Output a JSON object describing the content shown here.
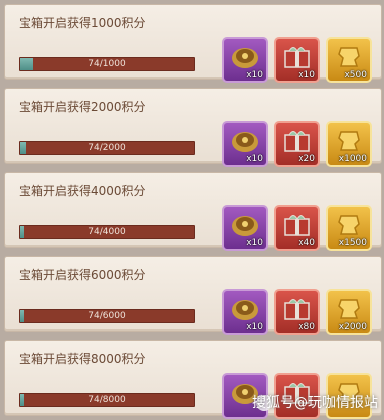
{
  "cards": [
    {
      "title": "宝箱开启获得1000积分",
      "progress_text": "74/1000",
      "progress": 0.074,
      "rewards": [
        {
          "icon": "treasure-chest-icon",
          "color": "purple",
          "count": "x10"
        },
        {
          "icon": "gift-box-icon",
          "color": "red",
          "count": "x10"
        },
        {
          "icon": "gold-ingot-icon",
          "color": "gold",
          "count": "x500"
        }
      ]
    },
    {
      "title": "宝箱开启获得2000积分",
      "progress_text": "74/2000",
      "progress": 0.037,
      "rewards": [
        {
          "icon": "treasure-chest-icon",
          "color": "purple",
          "count": "x10"
        },
        {
          "icon": "gift-box-icon",
          "color": "red",
          "count": "x20"
        },
        {
          "icon": "gold-ingot-icon",
          "color": "gold",
          "count": "x1000"
        }
      ]
    },
    {
      "title": "宝箱开启获得4000积分",
      "progress_text": "74/4000",
      "progress": 0.0185,
      "rewards": [
        {
          "icon": "treasure-chest-icon",
          "color": "purple",
          "count": "x10"
        },
        {
          "icon": "gift-box-icon",
          "color": "red",
          "count": "x40"
        },
        {
          "icon": "gold-ingot-icon",
          "color": "gold",
          "count": "x1500"
        }
      ]
    },
    {
      "title": "宝箱开启获得6000积分",
      "progress_text": "74/6000",
      "progress": 0.0123,
      "rewards": [
        {
          "icon": "treasure-chest-icon",
          "color": "purple",
          "count": "x10"
        },
        {
          "icon": "gift-box-icon",
          "color": "red",
          "count": "x80"
        },
        {
          "icon": "gold-ingot-icon",
          "color": "gold",
          "count": "x2000"
        }
      ]
    },
    {
      "title": "宝箱开启获得8000积分",
      "progress_text": "74/8000",
      "progress": 0.00925,
      "rewards": [
        {
          "icon": "treasure-chest-icon",
          "color": "purple",
          "count": ""
        },
        {
          "icon": "gift-box-icon",
          "color": "red",
          "count": ""
        },
        {
          "icon": "gold-ingot-icon",
          "color": "gold",
          "count": ""
        }
      ]
    }
  ],
  "watermark": "搜狐号@玩咖情报站"
}
